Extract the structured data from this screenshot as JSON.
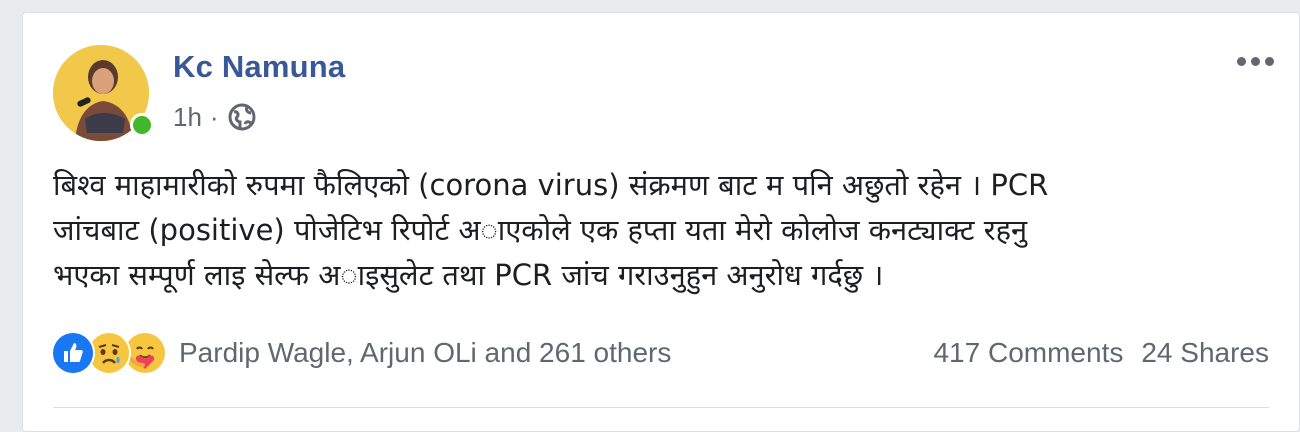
{
  "post": {
    "author": "Kc Namuna",
    "time": "1h",
    "separator": "·",
    "privacy_icon": "globe-icon",
    "more_icon": "more-options-icon",
    "text_lines": [
      "बिश्व माहामारीको रुपमा फैलिएको (corona virus) संक्रमण बाट म पनि अछुतो रहेन । PCR",
      "जांचबाट (positive) पोजेटिभ रिपोर्ट अाएकोले एक हप्ता यता मेरो कोलोज कनट्याक्ट रहनु",
      "भएका सम्पूर्ण लाइ सेल्फ अाइसुलेट तथा PCR जांच गराउनुहुन अनुरोध गर्दछु ।"
    ]
  },
  "reactions": {
    "icons": [
      "like-icon",
      "sad-icon",
      "care-icon"
    ],
    "names": "Pardip Wagle, Arjun OLi and 261 others",
    "comments": "417 Comments",
    "shares": "24 Shares"
  },
  "colors": {
    "author": "#385898",
    "meta": "#616770",
    "online": "#42b72a",
    "like": "#1877f2",
    "emoji": "#f7c640"
  }
}
